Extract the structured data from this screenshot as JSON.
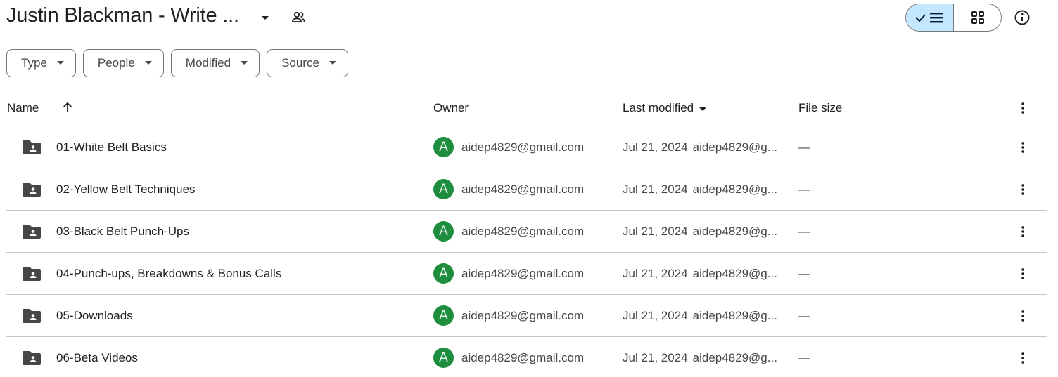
{
  "header": {
    "title": "Justin Blackman - Write ...",
    "title_menu_icon": "caret-down-icon",
    "shared_icon": "shared-people-icon",
    "view_toggle": {
      "list_label": "List layout",
      "grid_label": "Grid layout",
      "selected": "list"
    },
    "info_icon": "info-icon"
  },
  "filters": [
    {
      "label": "Type"
    },
    {
      "label": "People"
    },
    {
      "label": "Modified"
    },
    {
      "label": "Source"
    }
  ],
  "table": {
    "columns": {
      "name": "Name",
      "owner": "Owner",
      "last_modified": "Last modified",
      "file_size": "File size"
    },
    "sort": {
      "column": "name",
      "direction": "ascending"
    },
    "rows": [
      {
        "name": "01-White Belt Basics",
        "owner_initial": "A",
        "owner": "aidep4829@gmail.com",
        "modified_date": "Jul 21, 2024",
        "modified_by": "aidep4829@g...",
        "size": "—"
      },
      {
        "name": "02-Yellow Belt Techniques",
        "owner_initial": "A",
        "owner": "aidep4829@gmail.com",
        "modified_date": "Jul 21, 2024",
        "modified_by": "aidep4829@g...",
        "size": "—"
      },
      {
        "name": "03-Black Belt Punch-Ups",
        "owner_initial": "A",
        "owner": "aidep4829@gmail.com",
        "modified_date": "Jul 21, 2024",
        "modified_by": "aidep4829@g...",
        "size": "—"
      },
      {
        "name": "04-Punch-ups, Breakdowns & Bonus Calls",
        "owner_initial": "A",
        "owner": "aidep4829@gmail.com",
        "modified_date": "Jul 21, 2024",
        "modified_by": "aidep4829@g...",
        "size": "—"
      },
      {
        "name": "05-Downloads",
        "owner_initial": "A",
        "owner": "aidep4829@gmail.com",
        "modified_date": "Jul 21, 2024",
        "modified_by": "aidep4829@g...",
        "size": "—"
      },
      {
        "name": "06-Beta Videos",
        "owner_initial": "A",
        "owner": "aidep4829@gmail.com",
        "modified_date": "Jul 21, 2024",
        "modified_by": "aidep4829@g...",
        "size": "—"
      }
    ]
  },
  "colors": {
    "accent_selected": "#c2e7ff",
    "avatar_bg": "#1e8e3e",
    "text_primary": "#1f1f1f",
    "text_secondary": "#444746",
    "divider": "#c7c7c7"
  }
}
